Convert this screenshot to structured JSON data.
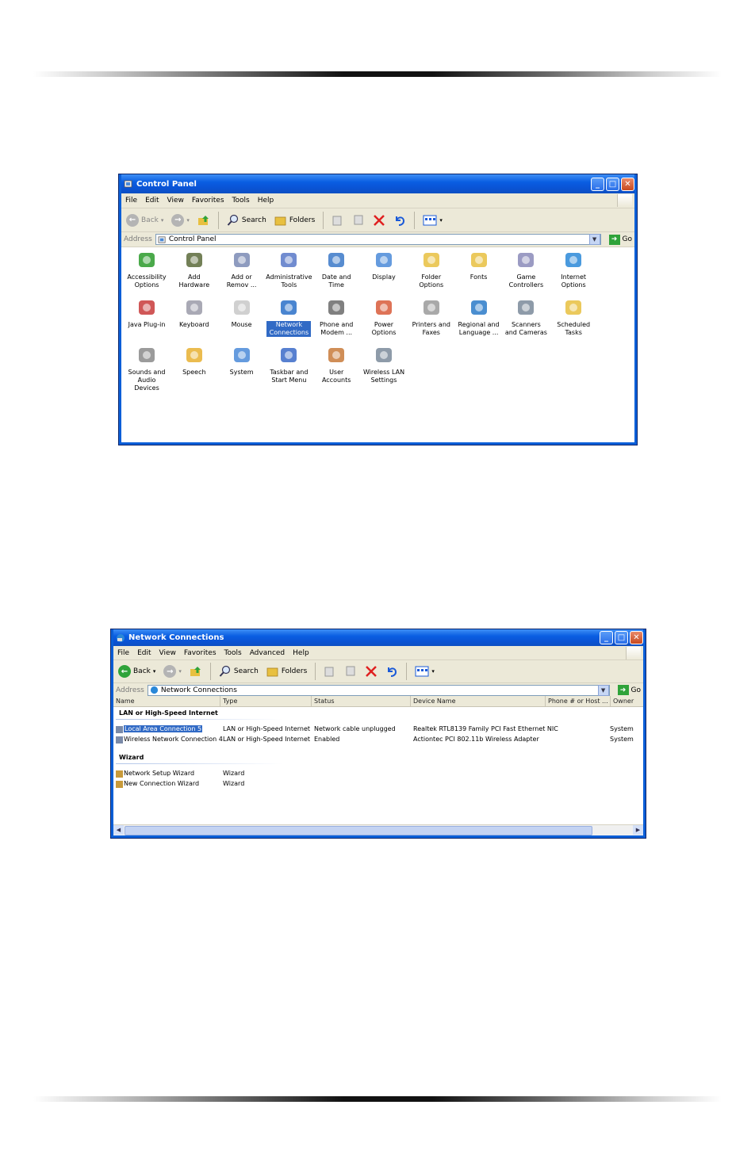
{
  "cp": {
    "title": "Control Panel",
    "menu": [
      "File",
      "Edit",
      "View",
      "Favorites",
      "Tools",
      "Help"
    ],
    "back": "Back",
    "search": "Search",
    "folders": "Folders",
    "address_label": "Address",
    "address_value": "Control Panel",
    "go": "Go",
    "items": [
      {
        "label": "Accessibility Options",
        "icon": "accessibility-icon",
        "color": "#2a9a2a"
      },
      {
        "label": "Add Hardware",
        "icon": "add-hardware-icon",
        "color": "#5a6a3a"
      },
      {
        "label": "Add or Remov ...",
        "icon": "add-remove-programs-icon",
        "color": "#7a8ab4"
      },
      {
        "label": "Administrative Tools",
        "icon": "administrative-tools-icon",
        "color": "#5878c8"
      },
      {
        "label": "Date and Time",
        "icon": "clock-icon",
        "color": "#3a78c8"
      },
      {
        "label": "Display",
        "icon": "display-icon",
        "color": "#4a8ad8"
      },
      {
        "label": "Folder Options",
        "icon": "folder-options-icon",
        "color": "#e8c040"
      },
      {
        "label": "Fonts",
        "icon": "fonts-icon",
        "color": "#e8c040"
      },
      {
        "label": "Game Controllers",
        "icon": "game-controller-icon",
        "color": "#8a8ab8"
      },
      {
        "label": "Internet Options",
        "icon": "internet-globe-icon",
        "color": "#2a88d8"
      },
      {
        "label": "Java Plug-in",
        "icon": "java-icon",
        "color": "#c83a3a"
      },
      {
        "label": "Keyboard",
        "icon": "keyboard-icon",
        "color": "#9a9aa8"
      },
      {
        "label": "Mouse",
        "icon": "mouse-icon",
        "color": "#c8c8c8"
      },
      {
        "label": "Network Connections",
        "icon": "network-globe-icon",
        "color": "#2a70c8"
      },
      {
        "label": "Phone and Modem ...",
        "icon": "phone-modem-icon",
        "color": "#6a6a6a"
      },
      {
        "label": "Power Options",
        "icon": "power-options-icon",
        "color": "#d85a3a"
      },
      {
        "label": "Printers and Faxes",
        "icon": "printer-icon",
        "color": "#9a9a9a"
      },
      {
        "label": "Regional and Language ...",
        "icon": "regional-globe-icon",
        "color": "#2a7ac8"
      },
      {
        "label": "Scanners and Cameras",
        "icon": "scanner-camera-icon",
        "color": "#7a8a9a"
      },
      {
        "label": "Scheduled Tasks",
        "icon": "scheduled-tasks-icon",
        "color": "#e8c040"
      },
      {
        "label": "Sounds and Audio Devices",
        "icon": "speaker-icon",
        "color": "#8a8a8a"
      },
      {
        "label": "Speech",
        "icon": "speech-icon",
        "color": "#e8b030"
      },
      {
        "label": "System",
        "icon": "system-icon",
        "color": "#4a8ad8"
      },
      {
        "label": "Taskbar and Start Menu",
        "icon": "taskbar-icon",
        "color": "#3a6ac8"
      },
      {
        "label": "User Accounts",
        "icon": "user-accounts-icon",
        "color": "#c87a3a"
      },
      {
        "label": "Wireless LAN Settings",
        "icon": "wireless-lan-icon",
        "color": "#7a8a9a"
      }
    ]
  },
  "nc": {
    "title": "Network Connections",
    "menu": [
      "File",
      "Edit",
      "View",
      "Favorites",
      "Tools",
      "Advanced",
      "Help"
    ],
    "back": "Back",
    "search": "Search",
    "folders": "Folders",
    "address_label": "Address",
    "address_value": "Network Connections",
    "go": "Go",
    "columns": [
      "Name",
      "Type",
      "Status",
      "Device Name",
      "Phone # or Host ...",
      "Owner"
    ],
    "groups": [
      {
        "label": "LAN or High-Speed Internet",
        "rows": [
          {
            "name": "Local Area Connection 5",
            "type": "LAN or High-Speed Internet",
            "status": "Network cable unplugged",
            "device": "Realtek RTL8139 Family PCI Fast Ethernet NIC",
            "owner": "System",
            "selected": true
          },
          {
            "name": "Wireless Network Connection 4",
            "type": "LAN or High-Speed Internet",
            "status": "Enabled",
            "device": "Actiontec PCI 802.11b Wireless Adapter",
            "owner": "System",
            "selected": false
          }
        ]
      },
      {
        "label": "Wizard",
        "rows": [
          {
            "name": "Network Setup Wizard",
            "type": "Wizard",
            "status": "",
            "device": "",
            "owner": "",
            "selected": false
          },
          {
            "name": "New Connection Wizard",
            "type": "Wizard",
            "status": "",
            "device": "",
            "owner": "",
            "selected": false
          }
        ]
      }
    ]
  },
  "colors": {
    "titlebar": "#0a5ee2",
    "selection": "#316ac5",
    "chrome": "#ece9d8"
  }
}
